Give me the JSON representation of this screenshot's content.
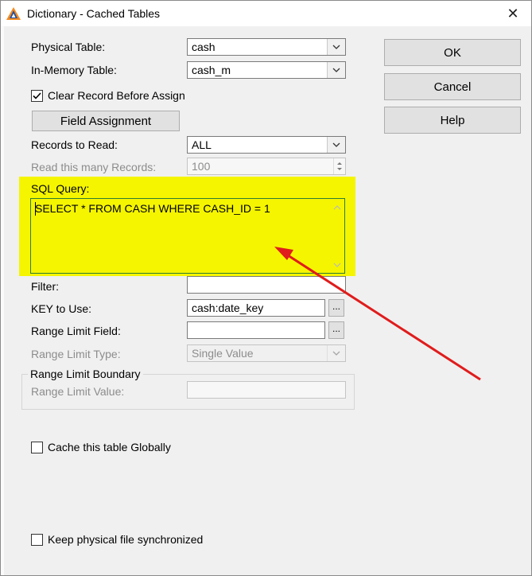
{
  "window": {
    "title": "Dictionary - Cached Tables",
    "close_glyph": "✕"
  },
  "form": {
    "physical_table": {
      "label": "Physical Table:",
      "value": "cash"
    },
    "in_memory_table": {
      "label": "In-Memory Table:",
      "value": "cash_m"
    },
    "clear_record": {
      "label": "Clear Record Before Assign",
      "checked": true
    },
    "field_assignment_button": "Field Assignment",
    "records_to_read": {
      "label": "Records to Read:",
      "value": "ALL"
    },
    "read_many": {
      "label": "Read this many Records:",
      "value": "100"
    },
    "sql_query": {
      "label": "SQL Query:",
      "value": "SELECT * FROM CASH WHERE CASH_ID = 1"
    },
    "filter": {
      "label": "Filter:",
      "value": ""
    },
    "key_to_use": {
      "label": "KEY to Use:",
      "value": "cash:date_key"
    },
    "range_limit_field": {
      "label": "Range Limit Field:",
      "value": ""
    },
    "range_limit_type": {
      "label": "Range Limit Type:",
      "value": "Single Value"
    },
    "range_limit_boundary": {
      "legend": "Range Limit Boundary",
      "label": "Range Limit Value:",
      "value": ""
    },
    "cache_globally": {
      "label": "Cache this table Globally",
      "checked": false
    },
    "keep_synchronized": {
      "label": "Keep physical file synchronized",
      "checked": false
    },
    "ellipsis": "..."
  },
  "buttons": {
    "ok": "OK",
    "cancel": "Cancel",
    "help": "Help"
  },
  "colors": {
    "highlight": "#f5f500",
    "arrow": "#e01c1c",
    "focus_border": "#2e7d32"
  }
}
